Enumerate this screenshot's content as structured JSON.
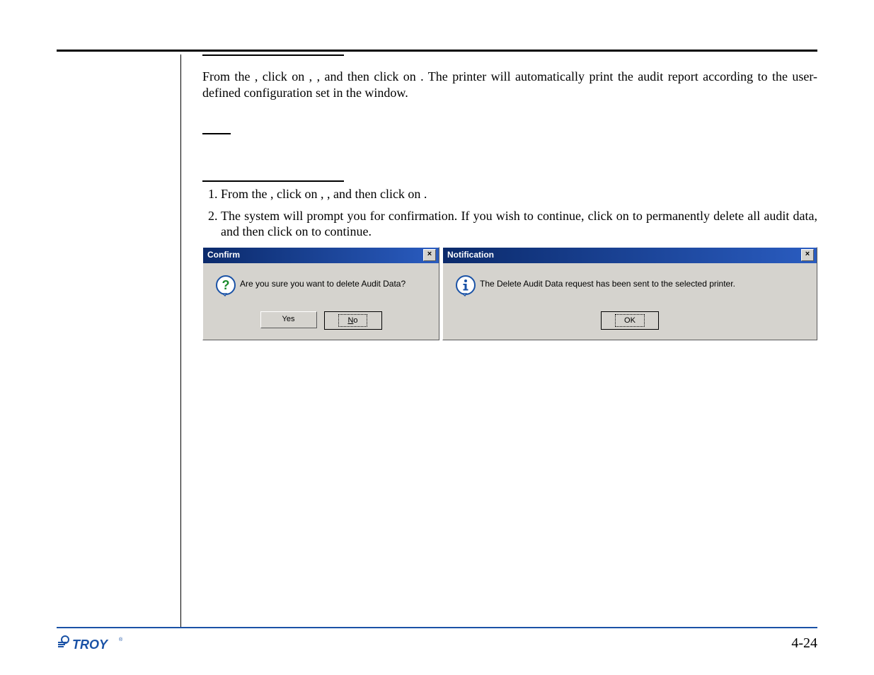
{
  "paragraph1": "From the , click on , , and then click on . The printer will automatically print the audit report according to the user-defined configuration set in the window.",
  "step1": "From the , click on , , and then click on .",
  "step2": "The system will prompt you for confirmation. If you wish to continue, click on to permanently delete all audit data, and then click on to continue.",
  "dialog_confirm": {
    "title": "Confirm",
    "message": "Are you sure you want to delete Audit Data?",
    "yes_label": "Yes",
    "no_label": "No",
    "close_label": "×"
  },
  "dialog_notify": {
    "title": "Notification",
    "message": "The Delete Audit Data request has been sent to the selected printer.",
    "ok_label": "OK",
    "close_label": "×"
  },
  "footer": {
    "brand": "TROY",
    "page_number": "4-24"
  },
  "colors": {
    "brand_blue": "#1a52a6",
    "titlebar_start": "#0b2a6b",
    "titlebar_end": "#2a5cc0",
    "dialog_face": "#d5d3ce"
  }
}
